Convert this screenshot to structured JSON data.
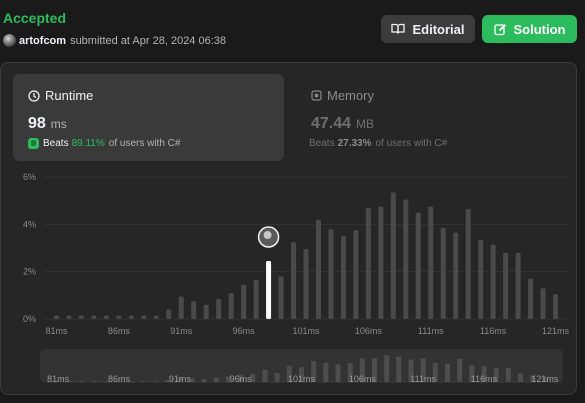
{
  "header": {
    "status": "Accepted",
    "username": "artofcom",
    "submitted_text": "submitted at Apr 28, 2024 06:38"
  },
  "buttons": {
    "editorial_label": "Editorial",
    "solution_label": "Solution",
    "editorial_icon": "book-icon",
    "solution_icon": "edit-icon"
  },
  "runtime": {
    "title": "Runtime",
    "value": "98",
    "unit": "ms",
    "beats_label": "Beats",
    "beats_pct": "89.11%",
    "beats_suffix": "of users with C#",
    "icon": "clock-icon"
  },
  "memory": {
    "title": "Memory",
    "value": "47.44",
    "unit": "MB",
    "beats_label": "Beats",
    "beats_pct": "27.33%",
    "beats_suffix": "of users with C#",
    "icon": "chip-icon"
  },
  "colors": {
    "accent": "#2cbb5d",
    "bar": "#4a4a4a",
    "highlight_bar": "#ffffff",
    "panel": "#262626"
  },
  "chart_data": {
    "type": "bar",
    "xlabel": "",
    "ylabel": "",
    "y_ticks": [
      "0%",
      "2%",
      "4%",
      "6%"
    ],
    "ylim": [
      0,
      6
    ],
    "x_tick_labels": [
      "81ms",
      "86ms",
      "91ms",
      "96ms",
      "101ms",
      "106ms",
      "111ms",
      "116ms",
      "121ms"
    ],
    "x": [
      81,
      82,
      83,
      84,
      85,
      86,
      87,
      88,
      89,
      90,
      91,
      92,
      93,
      94,
      95,
      96,
      97,
      98,
      99,
      100,
      101,
      102,
      103,
      104,
      105,
      106,
      107,
      108,
      109,
      110,
      111,
      112,
      113,
      114,
      115,
      116,
      117,
      118,
      119,
      120,
      121
    ],
    "values": [
      0.15,
      0.15,
      0.15,
      0.15,
      0.15,
      0.15,
      0.15,
      0.15,
      0.15,
      0.4,
      0.95,
      0.75,
      0.6,
      0.85,
      1.1,
      1.45,
      1.65,
      2.45,
      1.8,
      3.25,
      2.95,
      4.2,
      3.8,
      3.5,
      3.75,
      4.7,
      4.75,
      5.35,
      5.05,
      4.5,
      4.75,
      3.85,
      3.65,
      4.65,
      3.35,
      3.15,
      2.8,
      2.8,
      1.7,
      1.3,
      1.05
    ],
    "highlight_x": 98,
    "grid": true,
    "navigator_tick_labels": [
      "81ms",
      "86ms",
      "91ms",
      "96ms",
      "101ms",
      "106ms",
      "111ms",
      "116ms",
      "121ms"
    ]
  }
}
